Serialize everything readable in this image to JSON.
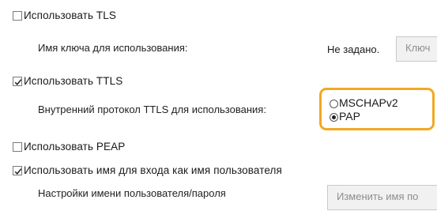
{
  "tls": {
    "checkbox_label": "Использовать TLS",
    "checked": false,
    "key_name_label": "Имя ключа для использования:",
    "key_name_value": "Не задано.",
    "key_button_label": "Ключ"
  },
  "ttls": {
    "checkbox_label": "Использовать TTLS",
    "checked": true,
    "inner_protocol_label": "Внутренний протокол TTLS для использования:",
    "options": [
      {
        "label": "MSCHAPv2",
        "selected": false
      },
      {
        "label": "PAP",
        "selected": true
      }
    ],
    "highlight_color": "#f2a821"
  },
  "peap": {
    "checkbox_label": "Использовать PEAP",
    "checked": false
  },
  "login_as_username": {
    "checkbox_label": "Использовать имя для входа как имя пользователя",
    "checked": true
  },
  "credentials": {
    "label": "Настройки имени пользователя/пароля",
    "button_label": "Изменить имя по"
  }
}
